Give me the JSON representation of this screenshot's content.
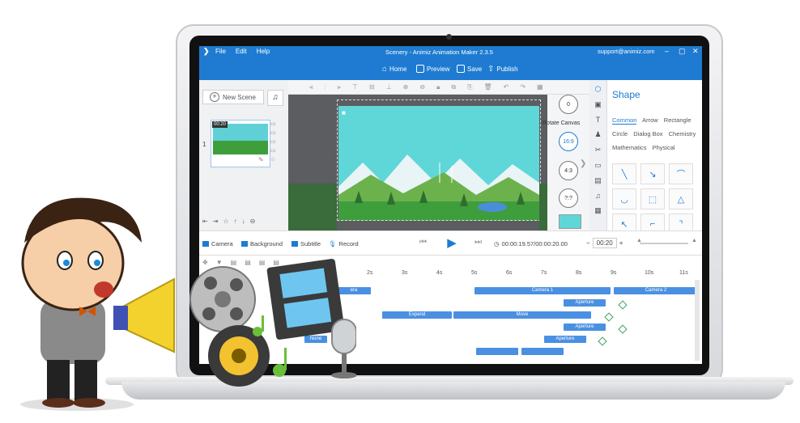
{
  "app": {
    "title": "Scenery - Animiz Animation Maker 2.3.5",
    "menu": [
      "File",
      "Edit",
      "Help"
    ],
    "support": "support@animiz.com"
  },
  "toolbar": {
    "home_label": "Home",
    "preview_label": "Preview",
    "save_label": "Save",
    "publish_label": "Publish"
  },
  "scenes": {
    "new_scene_label": "New Scene",
    "items": [
      {
        "index": "1",
        "time": "00:20"
      }
    ]
  },
  "canvas": {
    "rotate_label": "Rotate Canvas",
    "rotate_value": "0",
    "ratio_buttons": [
      "16:9",
      "4:3",
      "?:?"
    ]
  },
  "shape_panel": {
    "title": "Shape",
    "tabs": [
      "Common",
      "Arrow",
      "Rectangle",
      "Circle",
      "Dialog Box",
      "Chemistry",
      "Mathematics",
      "Physical"
    ],
    "active_tab": "Common"
  },
  "timeline_bar": {
    "camera_label": "Camera",
    "background_label": "Background",
    "subtitle_label": "Subtitle",
    "record_label": "Record",
    "time_display": "00:00:19.57/00:00:20.00",
    "duration_value": "00:20"
  },
  "timeline": {
    "ruler": [
      "2s",
      "3s",
      "4s",
      "5s",
      "6s",
      "7s",
      "8s",
      "9s",
      "10s",
      "11s"
    ],
    "tracks": [
      {
        "label": "Camera 1"
      },
      {
        "label": "Camera 2"
      },
      {
        "label": "Aperture"
      },
      {
        "label": "Expand"
      },
      {
        "label": "Move"
      },
      {
        "label": "Aperture"
      },
      {
        "label": "None"
      },
      {
        "label": "Aperture"
      }
    ],
    "partial_label": "era"
  },
  "colors": {
    "accent": "#1e7bd1",
    "track": "#4a90e2",
    "keyframe": "#3aa35a"
  }
}
